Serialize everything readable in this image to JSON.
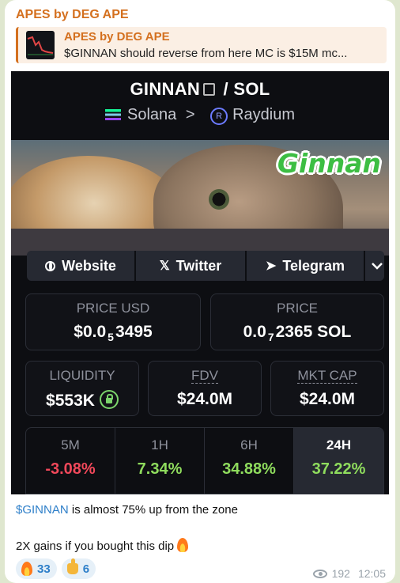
{
  "message": {
    "sender": "APES by DEG APE",
    "reply": {
      "name": "APES by DEG APE",
      "text": "$GINNAN should reverse from here  MC is $15M mc..."
    },
    "body_mention": "$GINNAN",
    "body_line1_rest": " is almost 75% up from the zone",
    "body_line2": "2X gains if you bought this dip",
    "reactions": [
      {
        "emoji": "fire-icon",
        "count": "33"
      },
      {
        "emoji": "thumbs-up-icon",
        "count": "6"
      }
    ],
    "views": "192",
    "time": "12:05"
  },
  "token": {
    "symbol": "GINNAN",
    "quote": "/ SOL",
    "chain": "Solana",
    "separator": ">",
    "dex": "Raydium",
    "banner_text": "Ginnan",
    "links": {
      "website": "Website",
      "twitter": "Twitter",
      "telegram": "Telegram"
    },
    "price_usd_label": "PRICE USD",
    "price_usd": {
      "prefix": "$0.0",
      "sub": "5",
      "suffix": "3495"
    },
    "price_label": "PRICE",
    "price_sol": {
      "prefix": "0.0",
      "sub": "7",
      "suffix": "2365 SOL"
    },
    "liquidity_label": "LIQUIDITY",
    "liquidity": "$553K",
    "fdv_label": "FDV",
    "fdv": "$24.0M",
    "mcap_label": "MKT CAP",
    "mcap": "$24.0M",
    "changes": [
      {
        "label": "5M",
        "value": "-3.08%",
        "color": "#f0485a"
      },
      {
        "label": "1H",
        "value": "7.34%",
        "color": "#8fdc5d"
      },
      {
        "label": "6H",
        "value": "34.88%",
        "color": "#8fdc5d"
      },
      {
        "label": "24H",
        "value": "37.22%",
        "color": "#8fdc5d"
      }
    ]
  }
}
